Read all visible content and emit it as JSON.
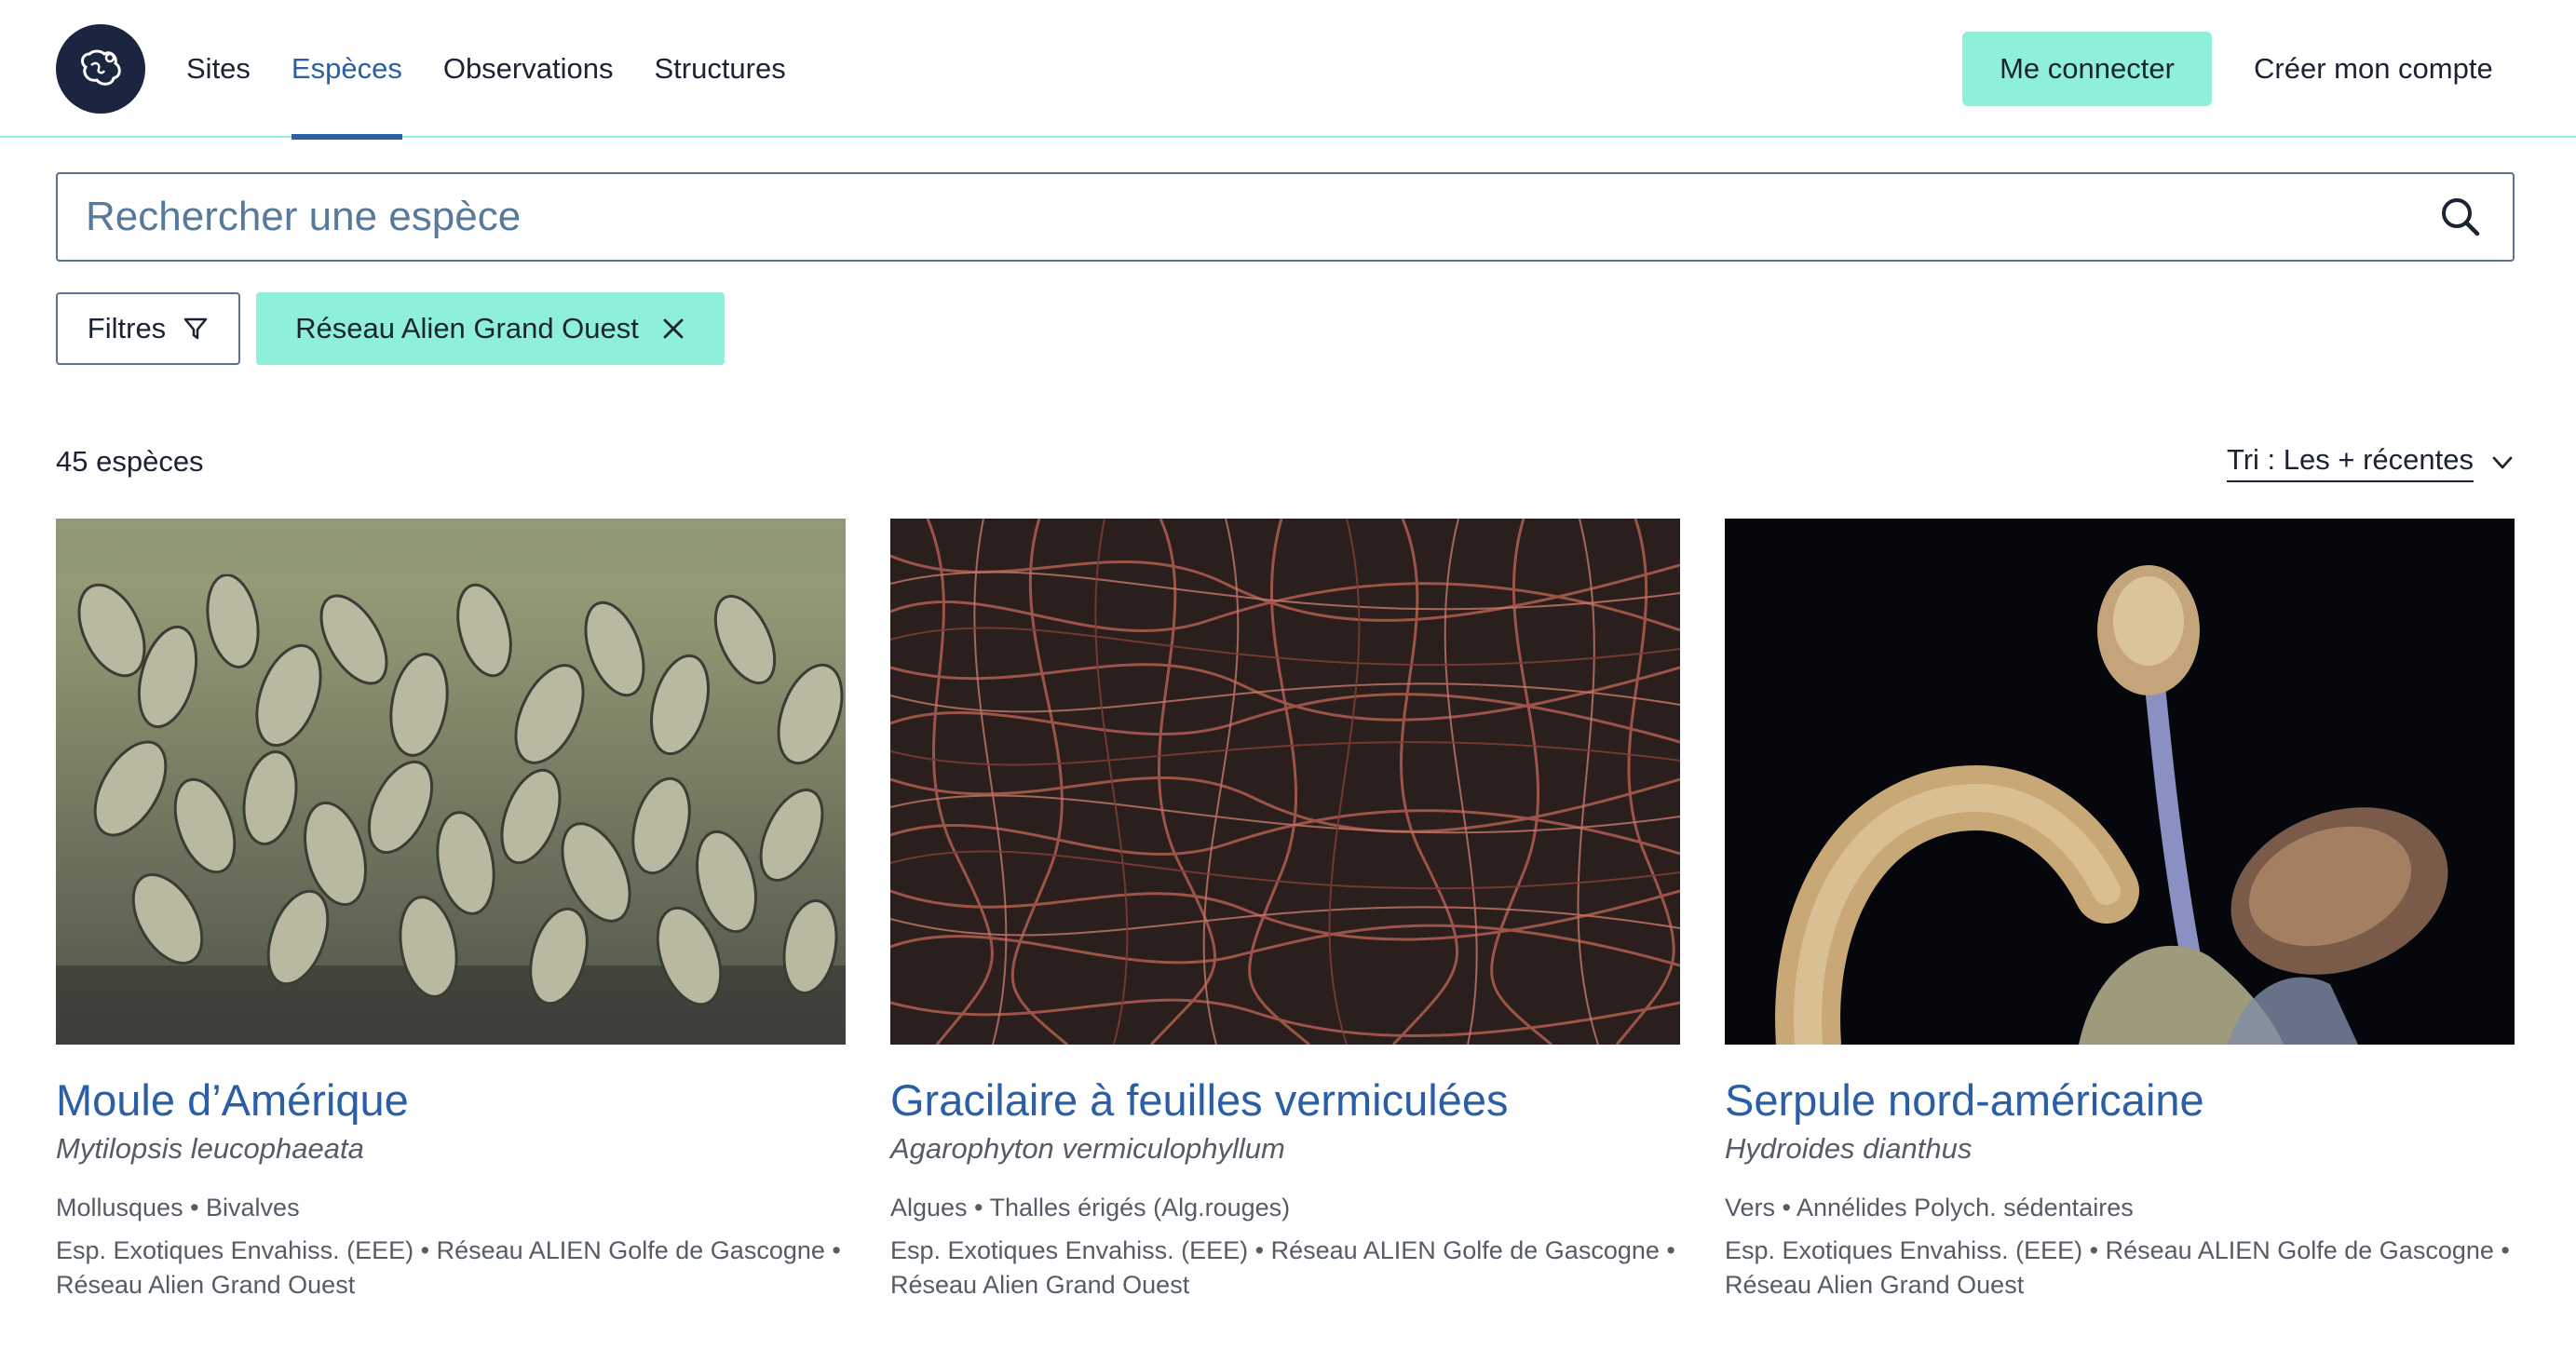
{
  "header": {
    "logo_label": "logo",
    "nav": [
      {
        "label": "Sites",
        "active": false
      },
      {
        "label": "Espèces",
        "active": true
      },
      {
        "label": "Observations",
        "active": false
      },
      {
        "label": "Structures",
        "active": false
      }
    ],
    "login_label": "Me connecter",
    "signup_label": "Créer mon compte"
  },
  "search": {
    "placeholder": "Rechercher une espèce",
    "icon": "search-icon"
  },
  "filters": {
    "filters_label": "Filtres",
    "filter_icon": "filter-icon",
    "active_chip": "Réseau Alien Grand Ouest",
    "chip_icon": "close-icon"
  },
  "results": {
    "count_label": "45 espèces",
    "sort_label": "Tri : Les + récentes",
    "sort_icon": "chevron-down-icon"
  },
  "cards": [
    {
      "title": "Moule d’Amérique",
      "scientific_name": "Mytilopsis leucophaeata",
      "group": "Mollusques • Bivalves",
      "tags": "Esp. Exotiques Envahiss. (EEE) • Réseau ALIEN Golfe de Gascogne • Réseau Alien Grand Ouest"
    },
    {
      "title": "Gracilaire à feuilles vermiculées",
      "scientific_name": "Agarophyton vermiculophyllum",
      "group": "Algues • Thalles érigés (Alg.rouges)",
      "tags": "Esp. Exotiques Envahiss. (EEE) • Réseau ALIEN Golfe de Gascogne • Réseau Alien Grand Ouest"
    },
    {
      "title": "Serpule nord-américaine",
      "scientific_name": "Hydroides dianthus",
      "group": "Vers • Annélides Polych. sédentaires",
      "tags": "Esp. Exotiques Envahiss. (EEE) • Réseau ALIEN Golfe de Gascogne • Réseau Alien Grand Ouest"
    }
  ],
  "colors": {
    "accent": "#8ef0da",
    "link_blue": "#2a5ea6",
    "navy": "#1b2540"
  }
}
